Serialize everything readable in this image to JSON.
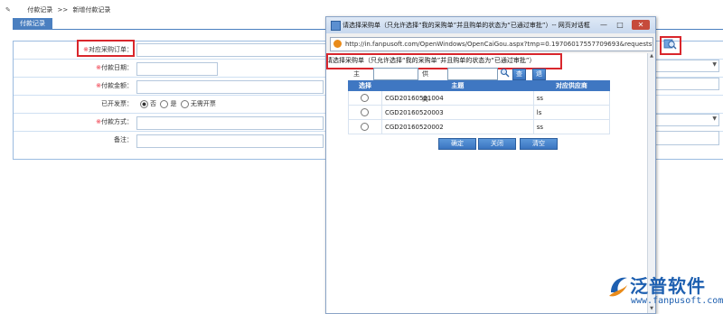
{
  "breadcrumb": {
    "parent": "付款记录",
    "separator": ">>",
    "current": "新增付款记录"
  },
  "tab": {
    "label": "付款记录"
  },
  "form": {
    "rows": [
      {
        "label": "对应采购订单：",
        "required": true
      },
      {
        "label": "付款日期：",
        "required": true
      },
      {
        "label": "付款金额：",
        "required": true
      },
      {
        "label": "已开发票：",
        "required": false
      },
      {
        "label": "付款方式：",
        "required": true
      },
      {
        "label": "备注：",
        "required": false
      }
    ],
    "required_mark": "※",
    "invoice_options": [
      "否",
      "是",
      "无需开票"
    ],
    "invoice_selected": "否"
  },
  "dialog": {
    "title": "请选择采购单（只允许选择“我的采购单”并且购单的状态为“已通过审批”）-- 网页对话框",
    "url": "http://in.fanpusoft.com/OpenWindows/OpenCaiGou.aspx?tmp=0.19706017557709693&requeststr",
    "prompt": "请选择采购单（只允许选择“我的采购单”并且购单的状态为“已通过审批”）",
    "search": {
      "subject_label": "主题:",
      "supplier_label": "供应商:",
      "query_button": "查询",
      "exit_button": "退出"
    },
    "table": {
      "headers": [
        "选择",
        "主题",
        "对应供应商"
      ],
      "rows": [
        {
          "subject": "CGD20160521004",
          "supplier": "ss"
        },
        {
          "subject": "CGD20160520003",
          "supplier": "ls"
        },
        {
          "subject": "CGD20160520002",
          "supplier": "ss"
        }
      ]
    },
    "actions": {
      "confirm": "确定",
      "close": "关闭",
      "clear": "清空"
    }
  },
  "logo": {
    "name": "泛普软件",
    "domain": "www.fanpusoft.com"
  },
  "colors": {
    "accent": "#3f77c2",
    "highlight": "#d9262c",
    "brand": "#1d5fb0"
  }
}
